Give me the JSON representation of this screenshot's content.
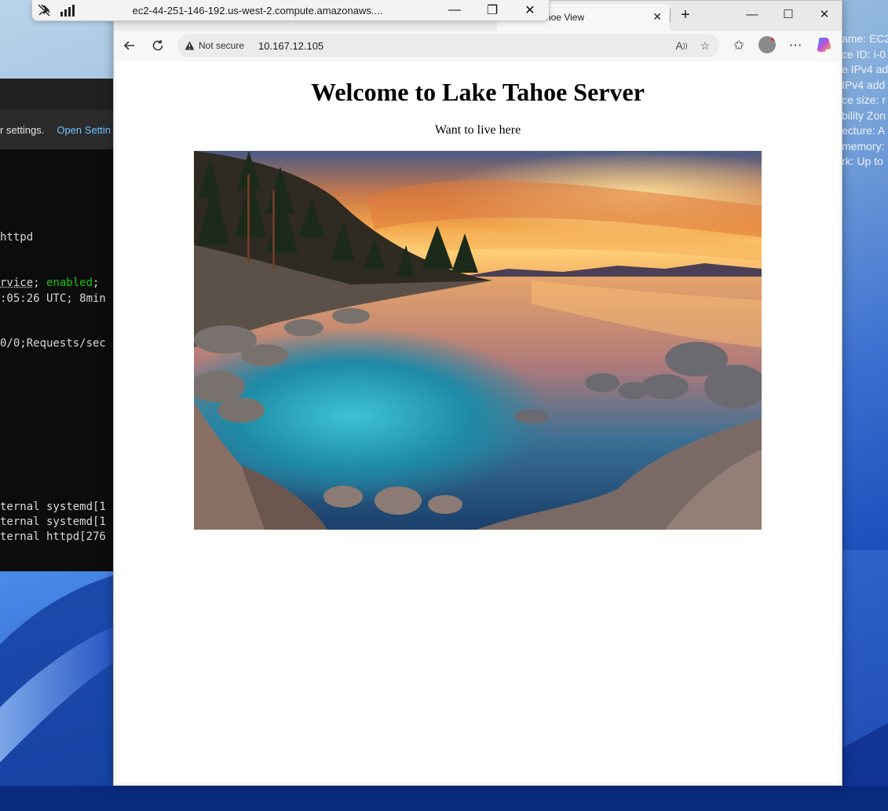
{
  "remote_session": {
    "host": "ec2-44-251-146-192.us-west-2.compute.amazonaws...."
  },
  "terminal": {
    "banner_text": "r settings.",
    "banner_link": "Open Settin",
    "lines": {
      "l1": "httpd",
      "l2a": "rvice",
      "l2b": "; ",
      "l2c": "enabled",
      "l2d": ";",
      "l3": ":05:26 UTC; 8min",
      "l4": "0/0;Requests/sec",
      "l5": "ternal systemd[1",
      "l6": "ternal systemd[1",
      "l7": "ternal httpd[276"
    }
  },
  "ec2_panel": {
    "lines": [
      "ame: EC2",
      "ce ID: i-0",
      "e IPv4 add",
      "IPv4 add",
      "ce size: r",
      "bility Zon",
      "ecture: A",
      "memory:",
      "rk: Up to"
    ]
  },
  "browser": {
    "tab_title": "hoe View",
    "address": {
      "security_label": "Not secure",
      "url": "10.167.12.105"
    }
  },
  "page": {
    "heading": "Welcome to Lake Tahoe Server",
    "subtitle": "Want to live here"
  },
  "colors": {
    "terminal_bg": "#0c0c0c",
    "terminal_green": "#16c60c",
    "link_blue": "#6cc4ff",
    "page_bg": "#ffffff",
    "window_chrome": "#f7f7f7"
  },
  "icons": {
    "rdp_pin": "pin-off-icon",
    "rdp_signal": "signal-bars-icon",
    "back": "arrow-left-icon",
    "refresh": "refresh-icon",
    "warning": "warning-triangle-icon",
    "read_aloud": "read-aloud-icon",
    "favorite": "star-icon",
    "favorites_list": "favorites-list-icon",
    "profile": "profile-avatar-icon",
    "more": "more-dots-icon",
    "copilot": "copilot-icon"
  }
}
